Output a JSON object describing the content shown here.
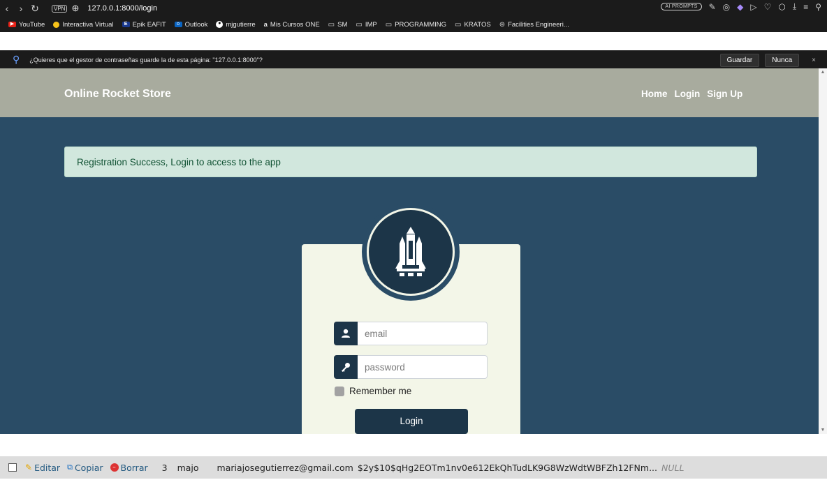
{
  "browser": {
    "url": "127.0.0.1:8000/login",
    "vpn_label": "VPN",
    "ai_prompts_label": "AI PROMPTS",
    "bookmarks": [
      {
        "icon": "youtube-icon",
        "label": "YouTube"
      },
      {
        "icon": "sun-icon",
        "label": "Interactiva Virtual"
      },
      {
        "icon": "epik-icon",
        "label": "Epik EAFIT"
      },
      {
        "icon": "outlook-icon",
        "label": "Outlook"
      },
      {
        "icon": "github-icon",
        "label": "mjgutierre"
      },
      {
        "icon": "amazon-icon",
        "label": "Mis Cursos ONE"
      },
      {
        "icon": "folder-icon",
        "label": "SM"
      },
      {
        "icon": "folder-icon",
        "label": "IMP"
      },
      {
        "icon": "folder-icon",
        "label": "PROGRAMMING"
      },
      {
        "icon": "folder-icon",
        "label": "KRATOS"
      },
      {
        "icon": "mercedes-icon",
        "label": "Facilities Engineeri..."
      }
    ],
    "password_prompt": {
      "text": "¿Quieres que el gestor de contraseñas guarde la de esta página: \"127.0.0.1:8000\"?",
      "save_label": "Guardar",
      "never_label": "Nunca",
      "close_label": "×"
    }
  },
  "site": {
    "brand": "Online Rocket Store",
    "nav": {
      "home": "Home",
      "login": "Login",
      "signup": "Sign Up"
    },
    "alert": "Registration Success, Login to access to the app",
    "form": {
      "email_placeholder": "email",
      "password_placeholder": "password",
      "remember_label": "Remember me",
      "login_label": "Login"
    }
  },
  "db_row": {
    "edit_label": "Editar",
    "copy_label": "Copiar",
    "delete_label": "Borrar",
    "id": "3",
    "name": "majo",
    "email": "mariajosegutierrez@gmail.com",
    "password_hash": "$2y$10$qHg2EOTm1nv0e612EkQhTudLK9G8WzWdtWBFZh12FNm...",
    "null_value": "NULL"
  },
  "colors": {
    "page_bg": "#2a4c66",
    "navbar_bg": "#a8ab9e",
    "alert_bg": "#d1e7dd",
    "card_bg": "#f3f6e8",
    "accent": "#1c3548"
  }
}
